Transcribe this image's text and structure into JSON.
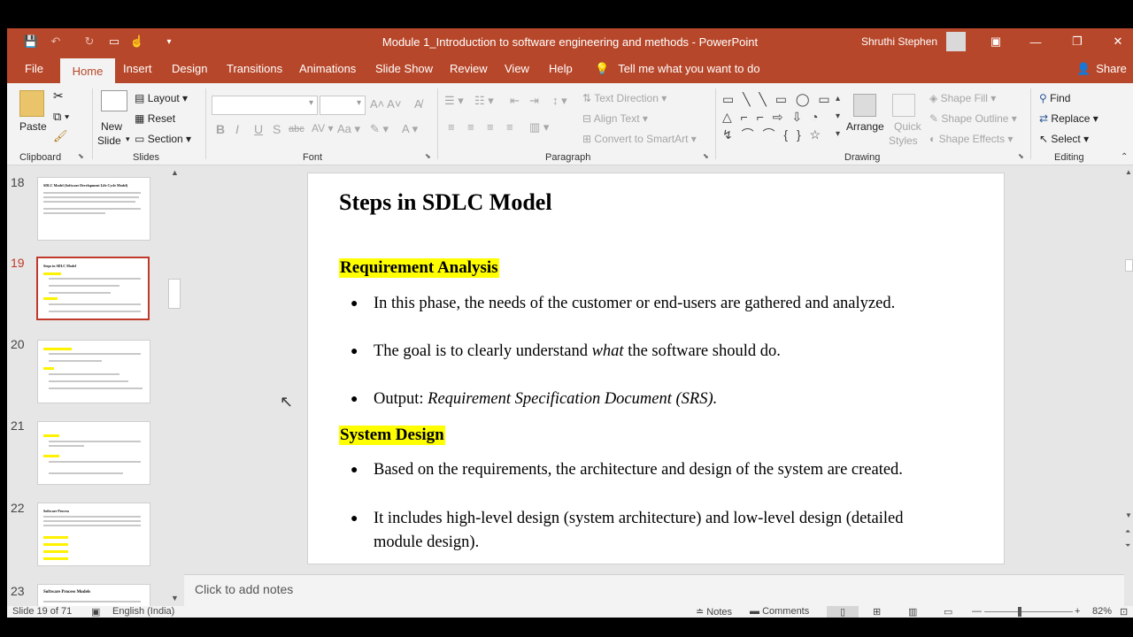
{
  "window": {
    "title": "Module 1_Introduction to software engineering and methods  -  PowerPoint",
    "user": "Shruthi Stephen"
  },
  "tabs": [
    {
      "label": "File"
    },
    {
      "label": "Home"
    },
    {
      "label": "Insert"
    },
    {
      "label": "Design"
    },
    {
      "label": "Transitions"
    },
    {
      "label": "Animations"
    },
    {
      "label": "Slide Show"
    },
    {
      "label": "Review"
    },
    {
      "label": "View"
    },
    {
      "label": "Help"
    }
  ],
  "tell_me": "Tell me what you want to do",
  "share": "Share",
  "ribbon": {
    "clipboard": {
      "label": "Clipboard",
      "paste": "Paste"
    },
    "slides": {
      "label": "Slides",
      "new_slide_1": "New",
      "new_slide_2": "Slide",
      "layout": "Layout",
      "reset": "Reset",
      "section": "Section"
    },
    "font": {
      "label": "Font"
    },
    "paragraph": {
      "label": "Paragraph",
      "text_direction": "Text Direction",
      "align_text": "Align Text",
      "convert_smartart": "Convert to SmartArt"
    },
    "drawing": {
      "label": "Drawing",
      "arrange": "Arrange",
      "quick_styles_1": "Quick",
      "quick_styles_2": "Styles",
      "shape_fill": "Shape Fill",
      "shape_outline": "Shape Outline",
      "shape_effects": "Shape Effects"
    },
    "editing": {
      "label": "Editing",
      "find": "Find",
      "replace": "Replace",
      "select": "Select"
    }
  },
  "thumbnails": [
    {
      "num": "18",
      "title": "SDLC Model (Software Development Life Cycle Model)"
    },
    {
      "num": "19",
      "title": "Steps in SDLC Model"
    },
    {
      "num": "20",
      "title": "Implementation / Coding"
    },
    {
      "num": "21",
      "title": "Deployment"
    },
    {
      "num": "22",
      "title": "Software Process"
    },
    {
      "num": "23",
      "title": "Software Process Models"
    }
  ],
  "slide": {
    "title": "Steps in SDLC Model",
    "section1": "Requirement Analysis",
    "b1": "In this phase, the needs of the customer or end-users are gathered and analyzed.",
    "b2_pre": "The goal is to clearly understand ",
    "b2_em": "what",
    "b2_post": " the software should do.",
    "b3_pre": "Output: ",
    "b3_em": "Requirement Specification Document (SRS).",
    "section2": "System Design",
    "b4": "Based on the requirements, the architecture and design of the system are created.",
    "b5_line1": "It includes high-level design (system architecture) and low-level design (detailed",
    "b5_line2": "module design)."
  },
  "notes_placeholder": "Click to add notes",
  "status": {
    "slide_count": "Slide 19 of 71",
    "language": "English (India)",
    "notes": "Notes",
    "comments": "Comments",
    "zoom": "82%"
  },
  "colors": {
    "brand": "#b7472a",
    "highlight": "#ffff00",
    "active_thumb": "#c0392b"
  }
}
